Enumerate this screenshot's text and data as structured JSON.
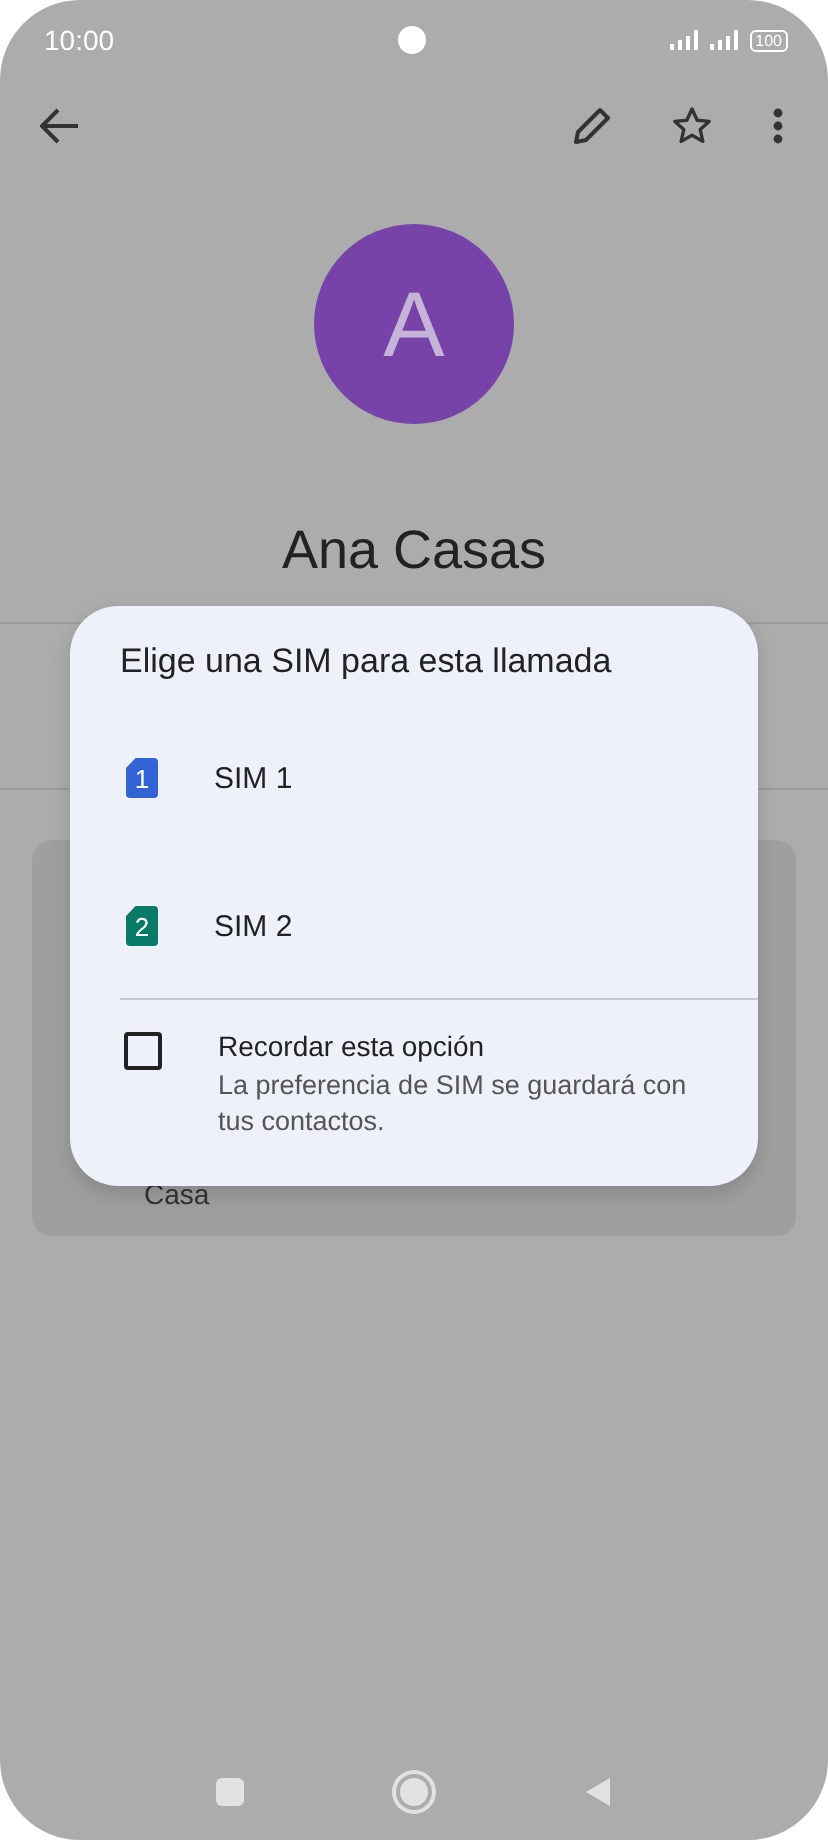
{
  "status_bar": {
    "time": "10:00",
    "battery": "100"
  },
  "contact": {
    "initial": "A",
    "name": "Ana Casas",
    "detail_label": "Casa"
  },
  "dialog": {
    "title": "Elige una SIM para esta llamada",
    "options": [
      {
        "number": "1",
        "label": "SIM 1",
        "color": "#3264d6"
      },
      {
        "number": "2",
        "label": "SIM 2",
        "color": "#0a7a68"
      }
    ],
    "remember": {
      "label": "Recordar esta opción",
      "description": "La preferencia de SIM se guardará con tus contactos.",
      "checked": false
    }
  }
}
